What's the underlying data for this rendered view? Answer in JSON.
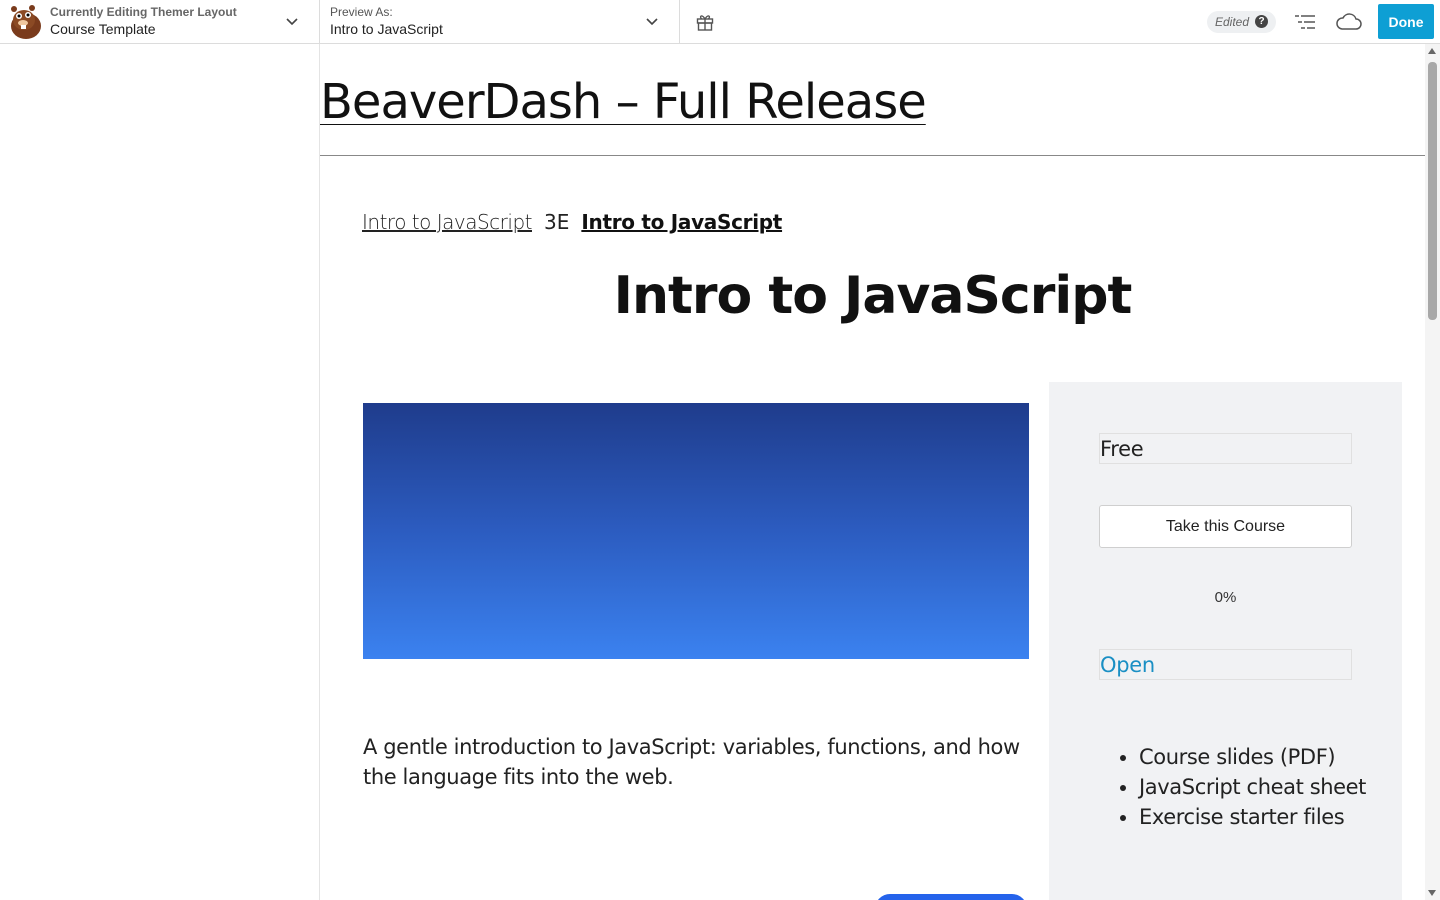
{
  "topbar": {
    "layout_label": "Currently Editing Themer Layout",
    "layout_name": "Course Template",
    "preview_label": "Preview As:",
    "preview_value": "Intro to JavaScript",
    "edited_label": "Edited",
    "help_glyph": "?",
    "done_label": "Done",
    "icons": [
      "beaver-logo-icon",
      "chevron-down-icon",
      "gift-icon",
      "help-icon",
      "outline-list-icon",
      "cloud-icon"
    ]
  },
  "page": {
    "site_title": "BeaverDash – Full Release",
    "breadcrumb": {
      "parent": "Intro to JavaScript",
      "separator": "3E",
      "current": "Intro to JavaScript"
    },
    "course_title": "Intro to JavaScript",
    "hero_colors": [
      "#1f3c8c",
      "#3b82f0"
    ],
    "description": "A gentle introduction to JavaScript: variables, functions, and how the language fits into the web."
  },
  "sidebar": {
    "price": "Free",
    "take_button": "Take this Course",
    "progress": "0%",
    "status": "Open",
    "materials": [
      "Course slides (PDF)",
      "JavaScript cheat sheet",
      "Exercise starter files"
    ]
  },
  "colors": {
    "done_button": "#0e9fd4",
    "status_link": "#1a8fc4",
    "sidebar_bg": "#f1f2f4"
  }
}
